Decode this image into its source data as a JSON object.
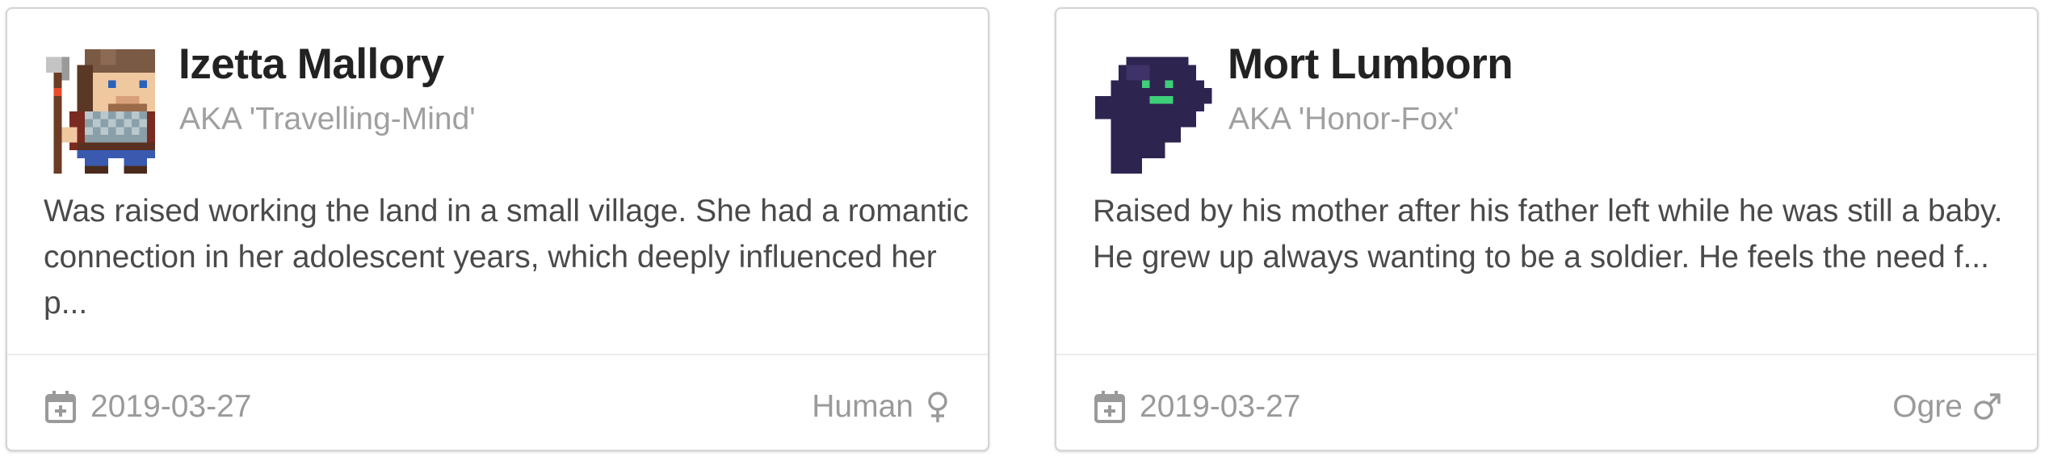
{
  "cards": [
    {
      "avatar_icon": "pixel-villager-with-axe",
      "name": "Izetta Mallory",
      "aka": "AKA 'Travelling-Mind'",
      "description": "Was raised working the land in a small village. She had a romantic connection in her adolescent years, which deeply influenced her p...",
      "date": "2019-03-27",
      "race": "Human",
      "gender_icon": "female-symbol-icon"
    },
    {
      "avatar_icon": "pixel-purple-ghost",
      "name": "Mort Lumborn",
      "aka": "AKA 'Honor-Fox'",
      "description": "Raised by his mother after his father left while he was still a baby. He grew up always wanting to be a soldier. He feels the need f...",
      "date": "2019-03-27",
      "race": "Ogre",
      "gender_icon": "male-symbol-icon"
    }
  ],
  "colors": {
    "name_text": "#222222",
    "meta_text": "#a0a0a0",
    "body_text": "#4a4a4a",
    "card_border": "#d4d4d5"
  }
}
